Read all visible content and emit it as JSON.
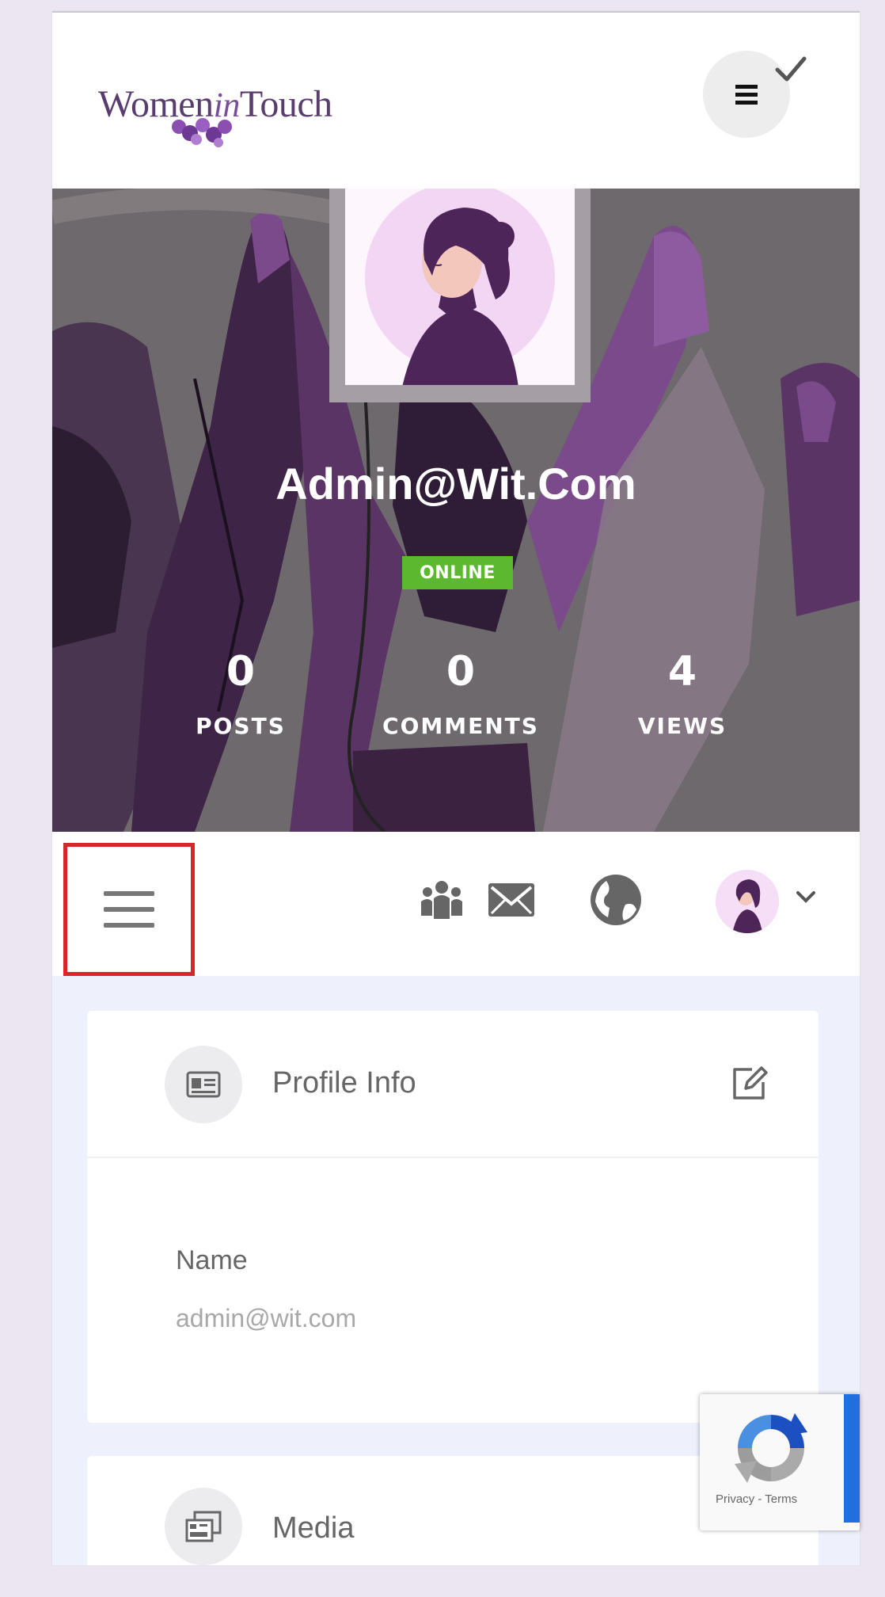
{
  "header": {
    "logo_text_left": "Women",
    "logo_text_in": "in",
    "logo_text_right": "Touch",
    "menu_icon": "hamburger-icon",
    "check_icon": "checkmark-icon"
  },
  "profile": {
    "username": "Admin@Wit.Com",
    "status": "ONLINE",
    "stats": [
      {
        "value": "0",
        "label": "POSTS"
      },
      {
        "value": "0",
        "label": "COMMENTS"
      },
      {
        "value": "4",
        "label": "VIEWS"
      }
    ]
  },
  "nav": {
    "icons": [
      "hamburger-icon",
      "group-icon",
      "mail-icon",
      "globe-icon",
      "user-avatar",
      "chevron-down-icon"
    ],
    "highlight_color": "#d8262a"
  },
  "cards": {
    "profile_info": {
      "title": "Profile Info",
      "field_label": "Name",
      "field_value": "admin@wit.com"
    },
    "media": {
      "title": "Media"
    }
  },
  "recaptcha": {
    "text": "Privacy - Terms"
  },
  "colors": {
    "accent": "#5a2a6e",
    "online": "#5cb82e",
    "background": "#ebe6f1"
  }
}
